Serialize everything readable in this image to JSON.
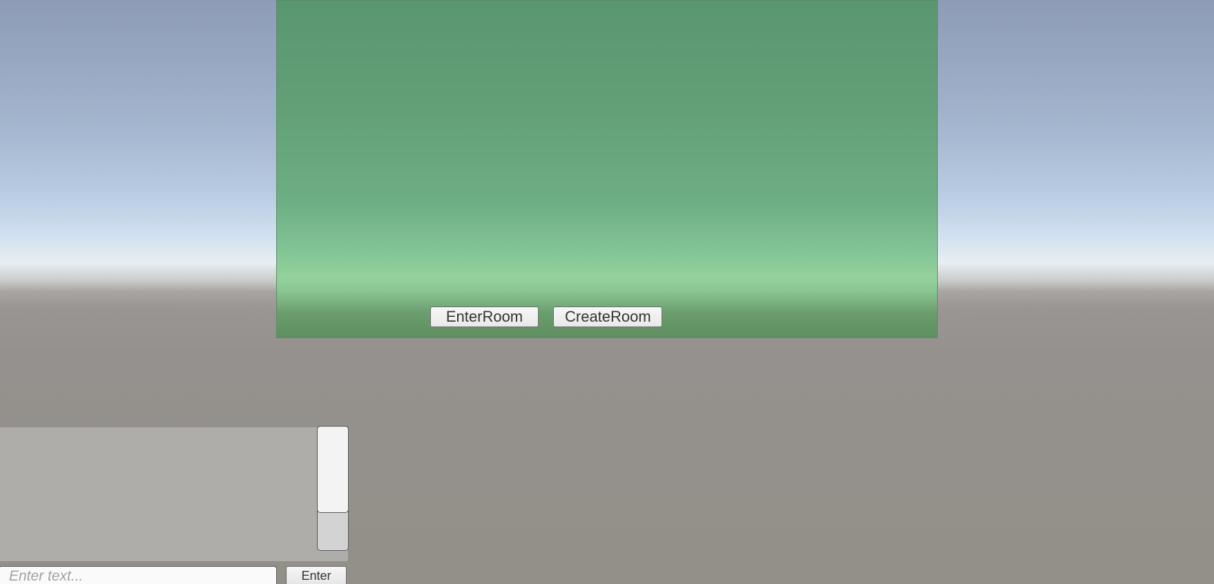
{
  "lobby": {
    "enter_room_label": "EnterRoom",
    "create_room_label": "CreateRoom"
  },
  "chat": {
    "input_placeholder": "Enter text...",
    "input_value": "",
    "enter_label": "Enter"
  },
  "colors": {
    "panel_green": "#629f77",
    "sky_top": "#8d9bb6",
    "ground": "#95918e"
  }
}
